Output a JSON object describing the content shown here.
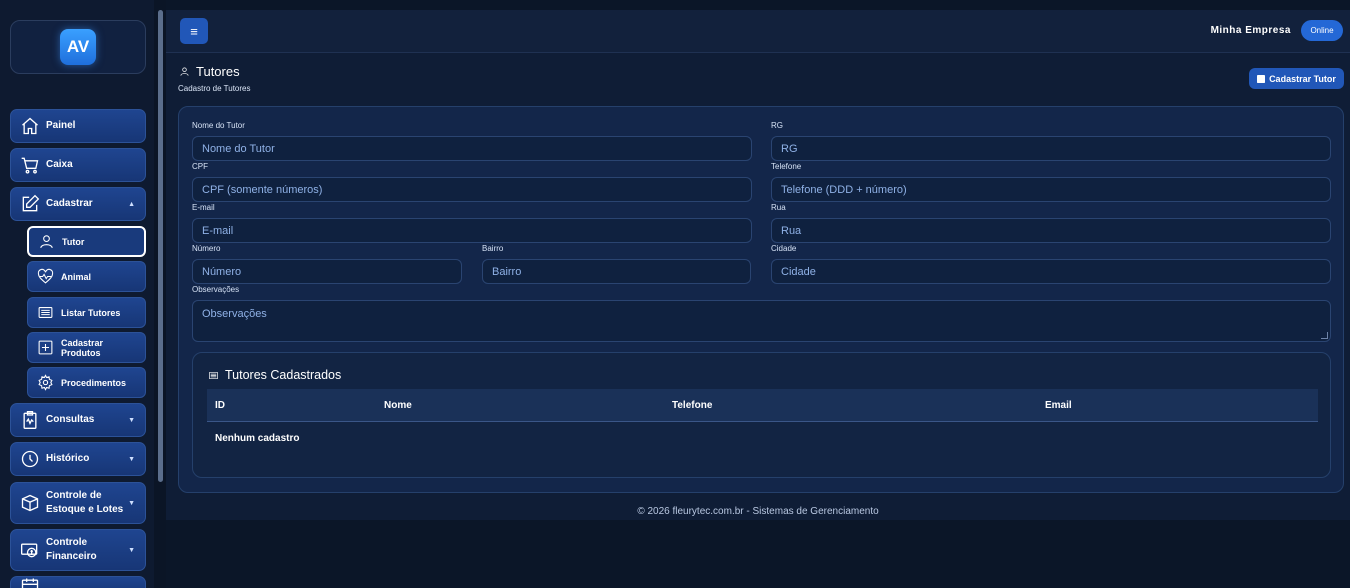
{
  "sidebar": {
    "logo": "AV",
    "items": [
      {
        "label": "Painel",
        "icon": "home-icon"
      },
      {
        "label": "Caixa",
        "icon": "cart-icon"
      },
      {
        "label": "Cadastrar",
        "icon": "edit-icon",
        "caret": "▲"
      },
      {
        "label": "Consultas",
        "icon": "clipboard-icon",
        "caret": "▼"
      },
      {
        "label": "Histórico",
        "icon": "clock-icon",
        "caret": "▼"
      },
      {
        "label": "Controle de Estoque e Lotes",
        "line1": "Controle de",
        "line2": "Estoque e Lotes",
        "icon": "box-icon",
        "caret": "▼"
      },
      {
        "label": "Controle Financeiro",
        "line1": "Controle",
        "line2": "Financeiro",
        "icon": "money-icon",
        "caret": "▼"
      }
    ],
    "subitems": [
      {
        "label": "Tutor",
        "icon": "user-icon"
      },
      {
        "label": "Animal",
        "icon": "heart-pulse-icon"
      },
      {
        "label": "Listar Tutores",
        "icon": "list-icon"
      },
      {
        "label": "Cadastrar Produtos",
        "icon": "plus-box-icon"
      },
      {
        "label": "Procedimentos",
        "icon": "gear-icon"
      }
    ]
  },
  "topbar": {
    "menu_icon": "≡",
    "company": "Minha Empresa",
    "status": "Online"
  },
  "page": {
    "title": "Tutores",
    "subtitle": "Cadastro de Tutores",
    "add_button": "Cadastrar Tutor"
  },
  "form": {
    "nome": {
      "label": "Nome do Tutor",
      "placeholder": "Nome do Tutor"
    },
    "rg": {
      "label": "RG",
      "placeholder": "RG"
    },
    "cpf": {
      "label": "CPF",
      "placeholder": "CPF (somente números)"
    },
    "telefone": {
      "label": "Telefone",
      "placeholder": "Telefone (DDD + número)"
    },
    "email": {
      "label": "E-mail",
      "placeholder": "E-mail"
    },
    "rua": {
      "label": "Rua",
      "placeholder": "Rua"
    },
    "numero": {
      "label": "Número",
      "placeholder": "Número"
    },
    "bairro": {
      "label": "Bairro",
      "placeholder": "Bairro"
    },
    "cidade": {
      "label": "Cidade",
      "placeholder": "Cidade"
    },
    "obs": {
      "label": "Observações",
      "placeholder": "Observações"
    }
  },
  "table": {
    "title": "Tutores Cadastrados",
    "columns": [
      "ID",
      "Nome",
      "Telefone",
      "Email"
    ],
    "empty": "Nenhum cadastro"
  },
  "footer": "© 2026 fleurytec.com.br - Sistemas de Gerenciamento"
}
